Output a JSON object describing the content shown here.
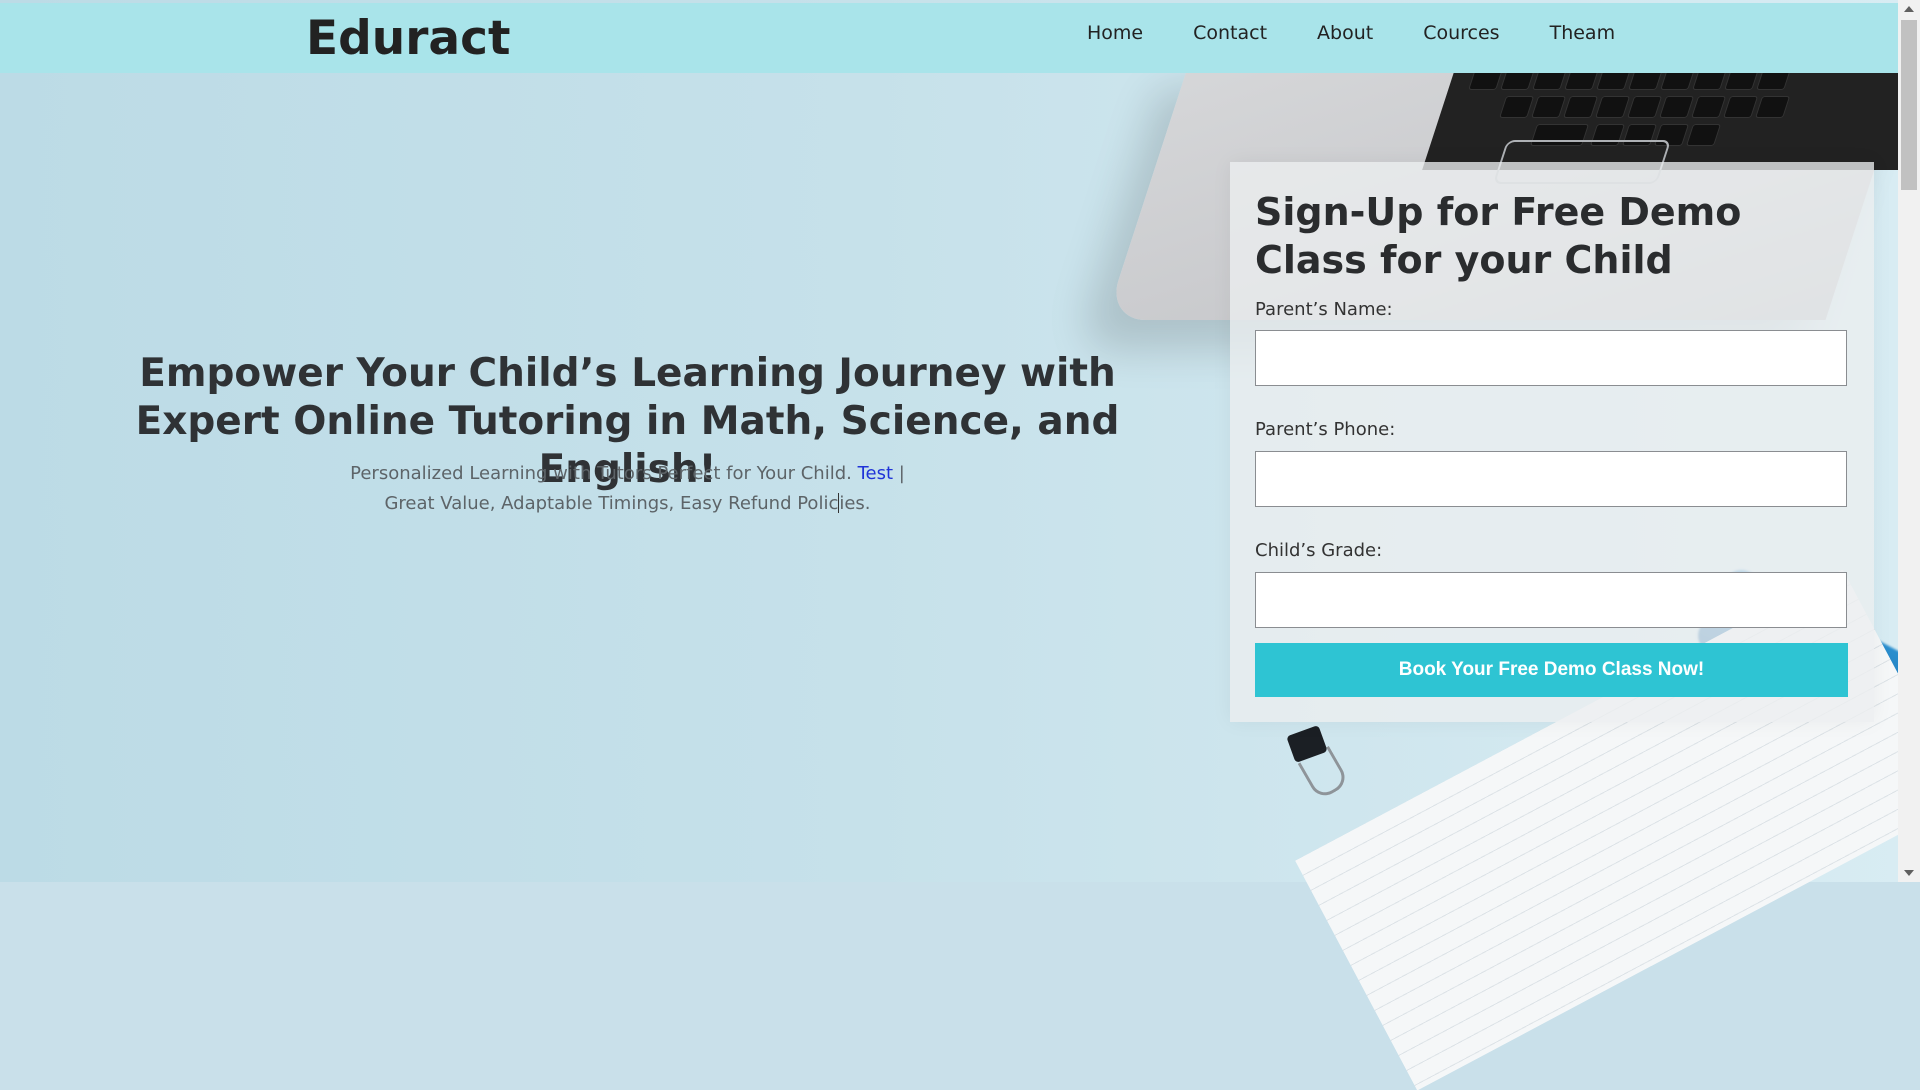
{
  "header": {
    "brand": "Eduract",
    "nav": [
      "Home",
      "Contact",
      "About",
      "Cources",
      "Theam"
    ]
  },
  "hero": {
    "title": "Empower Your Child’s Learning Journey with Expert Online Tutoring in Math, Science, and English!",
    "subtitle_line1": "Personalized Learning with Tutors Perfect for Your Child.",
    "subtitle_link": "Test",
    "subtitle_separator": "|",
    "subtitle_line2_a": "Great Value, Adaptable Timings, Easy Refund Polic",
    "subtitle_line2_b": "ies."
  },
  "form": {
    "title": "Sign-Up for Free Demo Class for your Child",
    "parent_name_label": "Parent’s Name:",
    "parent_name_value": "",
    "parent_phone_label": "Parent’s Phone:",
    "parent_phone_value": "",
    "child_grade_label": "Child’s Grade:",
    "child_grade_value": "",
    "submit_label": "Book Your Free Demo Class Now!"
  },
  "colors": {
    "header_bg": "#a9e4ea",
    "button_bg": "#2ec4d3",
    "link": "#1f33d8"
  },
  "icons": {
    "scroll_up": "triangle-up-icon",
    "scroll_down": "triangle-down-icon"
  }
}
